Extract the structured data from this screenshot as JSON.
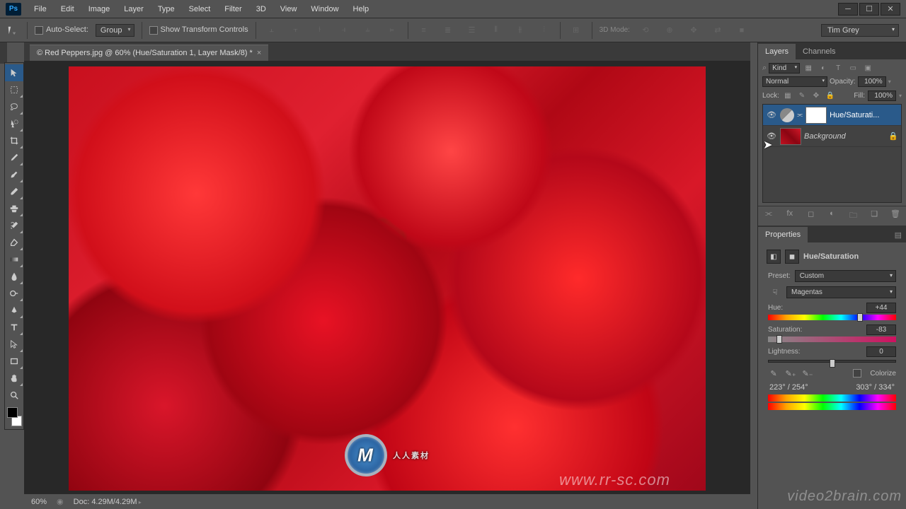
{
  "menu": {
    "items": [
      "File",
      "Edit",
      "Image",
      "Layer",
      "Type",
      "Select",
      "Filter",
      "3D",
      "View",
      "Window",
      "Help"
    ]
  },
  "options": {
    "auto_select_label": "Auto-Select:",
    "group_dd": "Group",
    "show_transform_label": "Show Transform Controls",
    "mode3d_label": "3D Mode:",
    "workspace": "Tim Grey"
  },
  "doc_tab": {
    "title": "© Red Peppers.jpg @ 60% (Hue/Saturation 1, Layer Mask/8) *",
    "close": "×"
  },
  "layers_panel": {
    "tab_layers": "Layers",
    "tab_channels": "Channels",
    "kind": "Kind",
    "blend": "Normal",
    "opacity_lbl": "Opacity:",
    "opacity_val": "100%",
    "lock_lbl": "Lock:",
    "fill_lbl": "Fill:",
    "fill_val": "100%",
    "layers": [
      {
        "name": "Hue/Saturati...",
        "type": "adjustment",
        "selected": true
      },
      {
        "name": "Background",
        "type": "bg",
        "locked": true
      }
    ]
  },
  "properties": {
    "tab": "Properties",
    "title": "Hue/Saturation",
    "preset_lbl": "Preset:",
    "preset_val": "Custom",
    "channel_val": "Magentas",
    "hue_lbl": "Hue:",
    "hue_val": "+44",
    "sat_lbl": "Saturation:",
    "sat_val": "-83",
    "lig_lbl": "Lightness:",
    "lig_val": "0",
    "colorize_lbl": "Colorize",
    "range_left": "223° / 254°",
    "range_right": "303° / 334°"
  },
  "status": {
    "zoom": "60%",
    "doc_info": "Doc: 4.29M/4.29M"
  },
  "watermarks": {
    "center": "人人素材",
    "center_sub": "www.rr-sc.com",
    "corner": "video2brain.com"
  }
}
